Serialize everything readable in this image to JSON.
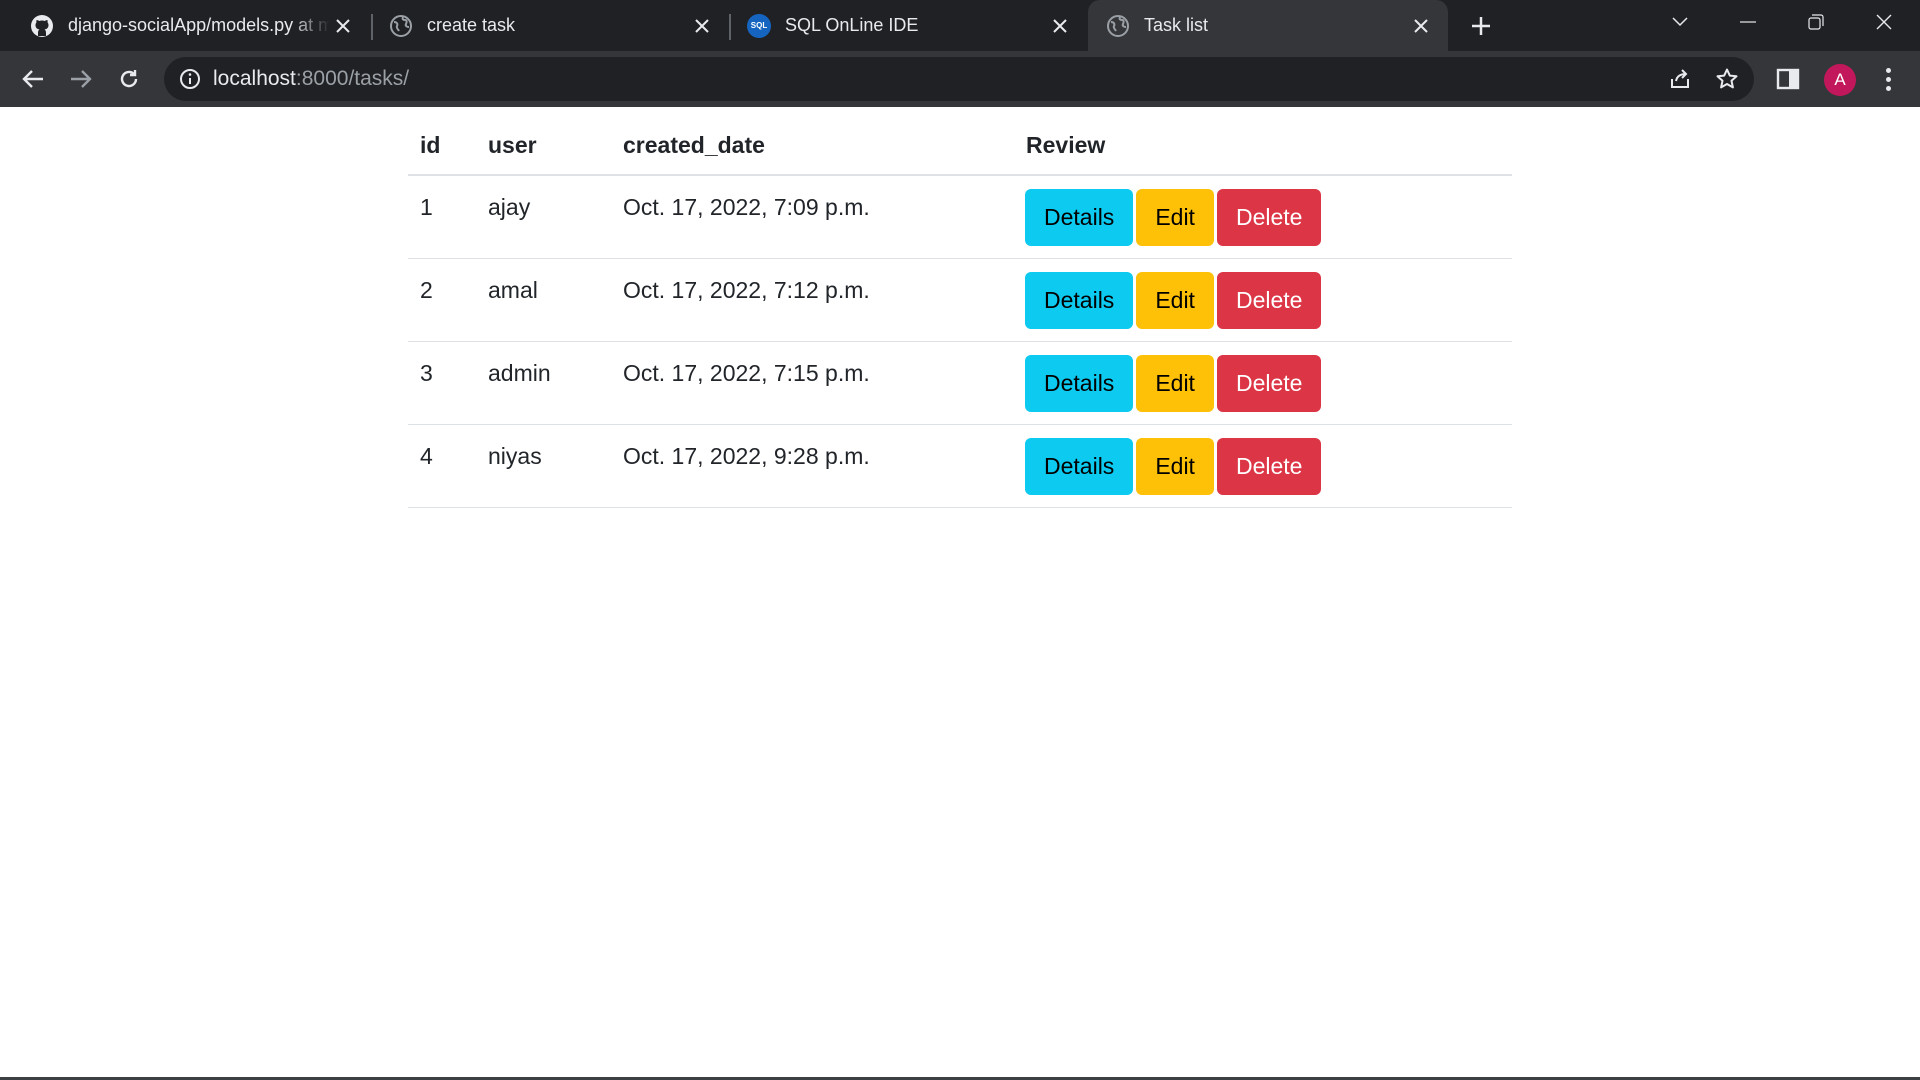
{
  "browser": {
    "tabs": [
      {
        "title": "django-socialApp/models.py at m",
        "icon": "github-icon",
        "active": false
      },
      {
        "title": "create task",
        "icon": "globe-icon",
        "active": false
      },
      {
        "title": "SQL OnLine IDE",
        "icon": "sql-icon",
        "active": false
      },
      {
        "title": "Task list",
        "icon": "globe-icon",
        "active": true
      }
    ],
    "sql_icon_text": "SQL",
    "url_host": "localhost",
    "url_rest": ":8000/tasks/",
    "profile_initial": "A",
    "colors": {
      "frame": "#202124",
      "toolbar": "#35363a",
      "avatar": "#c2185b"
    }
  },
  "table": {
    "headers": {
      "id": "id",
      "user": "user",
      "created_date": "created_date",
      "review": "Review"
    },
    "rows": [
      {
        "id": "1",
        "user": "ajay",
        "created_date": "Oct. 17, 2022, 7:09 p.m."
      },
      {
        "id": "2",
        "user": "amal",
        "created_date": "Oct. 17, 2022, 7:12 p.m."
      },
      {
        "id": "3",
        "user": "admin",
        "created_date": "Oct. 17, 2022, 7:15 p.m."
      },
      {
        "id": "4",
        "user": "niyas",
        "created_date": "Oct. 17, 2022, 9:28 p.m."
      }
    ],
    "actions": {
      "details": "Details",
      "edit": "Edit",
      "delete": "Delete"
    },
    "colors": {
      "details": "#0dcaf0",
      "edit": "#ffc107",
      "delete": "#dc3545"
    }
  }
}
